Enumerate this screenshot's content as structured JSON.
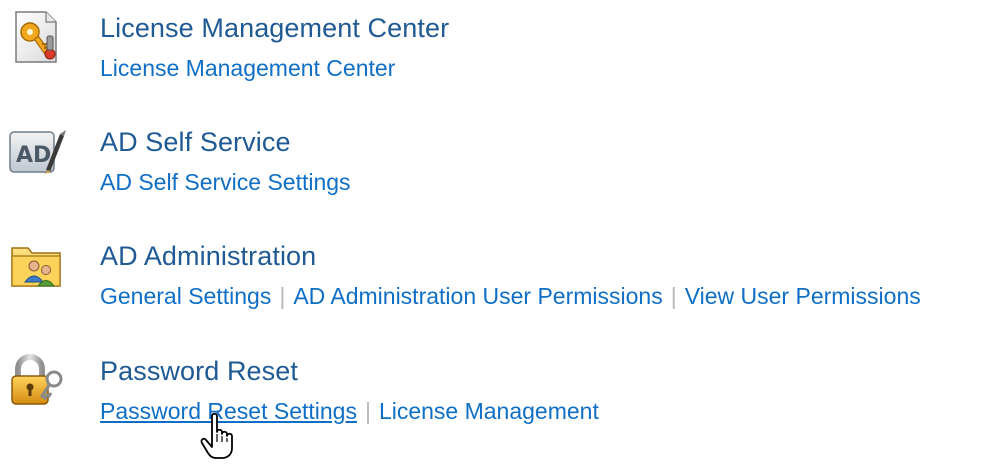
{
  "sections": [
    {
      "title": "License Management Center",
      "icon": "license-key-icon",
      "links": [
        {
          "label": "License Management Center"
        }
      ]
    },
    {
      "title": "AD Self Service",
      "icon": "ad-self-service-icon",
      "links": [
        {
          "label": "AD Self Service Settings"
        }
      ]
    },
    {
      "title": "AD Administration",
      "icon": "ad-administration-folder-icon",
      "links": [
        {
          "label": "General Settings"
        },
        {
          "label": "AD Administration User Permissions"
        },
        {
          "label": "View User Permissions"
        }
      ]
    },
    {
      "title": "Password Reset",
      "icon": "padlock-icon",
      "links": [
        {
          "label": "Password Reset Settings",
          "hovered": true
        },
        {
          "label": "License Management"
        }
      ]
    }
  ],
  "colors": {
    "title": "#1f5a94",
    "link": "#0f6fc6",
    "separator": "#b8b8b8"
  }
}
